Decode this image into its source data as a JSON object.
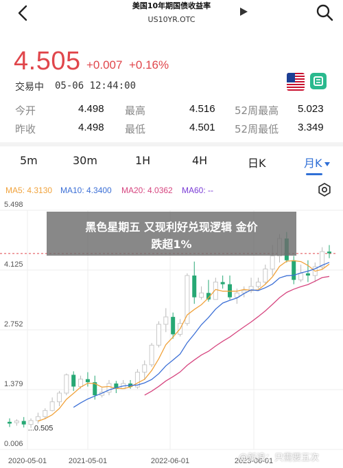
{
  "header": {
    "title": "美国10年期国债收益率",
    "symbol": "US10YR.OTC"
  },
  "quote": {
    "price": "4.505",
    "change": "+0.007",
    "change_pct": "+0.16%",
    "status": "交易中",
    "timestamp": "05-06 12:44:00"
  },
  "stats": [
    {
      "label": "今开",
      "value": "4.498"
    },
    {
      "label": "最高",
      "value": "4.516"
    },
    {
      "label": "52周最高",
      "value": "5.023"
    },
    {
      "label": "昨收",
      "value": "4.498"
    },
    {
      "label": "最低",
      "value": "4.501"
    },
    {
      "label": "52周最低",
      "value": "3.349"
    }
  ],
  "tabs": [
    "5m",
    "30m",
    "1H",
    "4H",
    "日K",
    "月K"
  ],
  "active_tab": "月K",
  "ma_legend": [
    {
      "label": "MA5: 4.3130",
      "color": "#f0a23b"
    },
    {
      "label": "MA10: 4.3400",
      "color": "#3b6fd6"
    },
    {
      "label": "MA20: 4.0362",
      "color": "#d6457f"
    },
    {
      "label": "MA60: --",
      "color": "#7a3bd6"
    }
  ],
  "overlay": {
    "line1": "黑色星期五 又现利好兑现逻辑 金价",
    "line2": "跌超1%"
  },
  "watermark": "@新浪：只需要五次",
  "colors": {
    "up": "#e0464b",
    "down": "#26a874",
    "accent": "#2f6fd6"
  },
  "chart_data": {
    "type": "candlestick",
    "y_ticks": [
      "5.498",
      "4.125",
      "2.752",
      "1.379",
      "0.006"
    ],
    "ylim": [
      0.006,
      5.498
    ],
    "x_ticks": [
      "2020-05-01",
      "2021-05-01",
      "2022-06-01",
      "2023-06-01"
    ],
    "annotations": [
      "0.505"
    ],
    "current_value": 4.505,
    "candles": [
      [
        0.64,
        0.72,
        0.52,
        0.6
      ],
      [
        0.62,
        0.7,
        0.55,
        0.66
      ],
      [
        0.66,
        0.75,
        0.51,
        0.58
      ],
      [
        0.58,
        0.72,
        0.5,
        0.67
      ],
      [
        0.67,
        0.85,
        0.6,
        0.76
      ],
      [
        0.76,
        0.95,
        0.7,
        0.9
      ],
      [
        0.9,
        1.2,
        0.88,
        1.1
      ],
      [
        1.1,
        1.35,
        1.0,
        1.3
      ],
      [
        1.3,
        1.75,
        1.25,
        1.72
      ],
      [
        1.72,
        1.8,
        1.35,
        1.45
      ],
      [
        1.45,
        1.7,
        1.4,
        1.62
      ],
      [
        1.62,
        1.78,
        1.45,
        1.55
      ],
      [
        1.55,
        1.7,
        1.15,
        1.25
      ],
      [
        1.25,
        1.42,
        1.2,
        1.32
      ],
      [
        1.32,
        1.6,
        1.25,
        1.52
      ],
      [
        1.52,
        1.58,
        1.3,
        1.4
      ],
      [
        1.4,
        1.6,
        1.4,
        1.52
      ],
      [
        1.52,
        1.6,
        1.4,
        1.44
      ],
      [
        1.44,
        1.85,
        1.4,
        1.78
      ],
      [
        1.78,
        2.05,
        1.6,
        1.95
      ],
      [
        1.95,
        2.45,
        1.9,
        2.4
      ],
      [
        2.4,
        2.95,
        2.35,
        2.88
      ],
      [
        2.88,
        3.25,
        2.7,
        3.05
      ],
      [
        3.05,
        3.15,
        2.55,
        2.65
      ],
      [
        2.65,
        3.0,
        2.6,
        2.9
      ],
      [
        2.9,
        4.05,
        2.85,
        4.0
      ],
      [
        4.0,
        4.32,
        3.35,
        3.5
      ],
      [
        3.5,
        3.75,
        3.45,
        3.6
      ],
      [
        3.6,
        3.9,
        3.4,
        3.45
      ],
      [
        3.45,
        3.95,
        3.45,
        3.85
      ],
      [
        3.85,
        4.0,
        3.7,
        3.8
      ],
      [
        3.8,
        4.0,
        3.45,
        3.5
      ],
      [
        3.5,
        3.7,
        3.35,
        3.6
      ],
      [
        3.6,
        3.75,
        3.5,
        3.65
      ],
      [
        3.65,
        3.95,
        3.6,
        3.75
      ],
      [
        3.75,
        3.95,
        3.7,
        3.85
      ],
      [
        3.85,
        4.25,
        3.8,
        4.15
      ],
      [
        4.15,
        4.7,
        4.0,
        4.45
      ],
      [
        4.45,
        4.95,
        4.3,
        4.85
      ],
      [
        4.85,
        5.0,
        4.3,
        4.35
      ],
      [
        4.35,
        4.45,
        3.8,
        3.9
      ],
      [
        3.9,
        4.25,
        3.85,
        4.05
      ],
      [
        4.05,
        4.35,
        3.85,
        4.0
      ],
      [
        4.0,
        4.3,
        3.85,
        4.2
      ],
      [
        4.2,
        4.65,
        4.15,
        4.55
      ],
      [
        4.55,
        4.7,
        4.4,
        4.51
      ]
    ]
  }
}
